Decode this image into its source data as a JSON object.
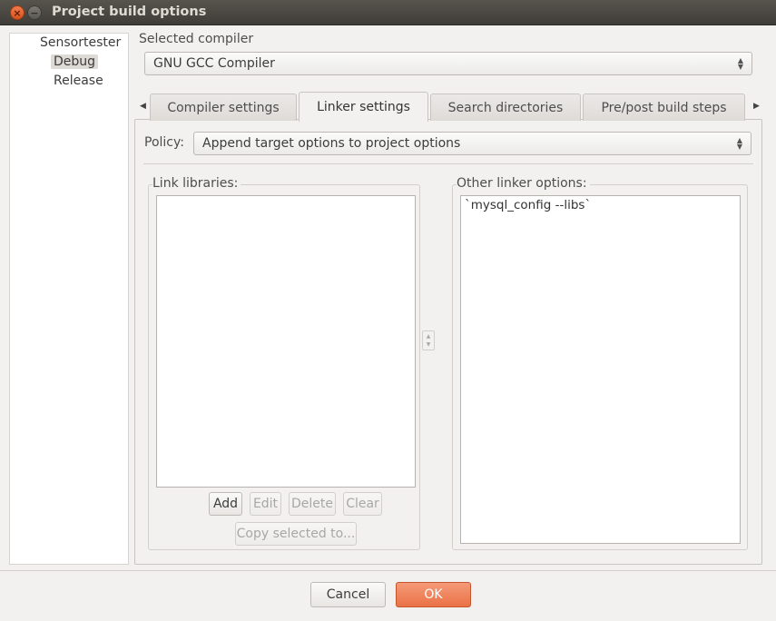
{
  "window": {
    "title": "Project build options"
  },
  "targets": [
    {
      "label": "Sensortester",
      "selected": false
    },
    {
      "label": "Debug",
      "selected": true
    },
    {
      "label": "Release",
      "selected": false
    }
  ],
  "compiler": {
    "label": "Selected compiler",
    "value": "GNU GCC Compiler"
  },
  "tabs": [
    {
      "label": "Compiler settings",
      "active": false
    },
    {
      "label": "Linker settings",
      "active": true
    },
    {
      "label": "Search directories",
      "active": false
    },
    {
      "label": "Pre/post build steps",
      "active": false
    }
  ],
  "policy": {
    "label": "Policy:",
    "value": "Append target options to project options"
  },
  "link_libraries": {
    "label": "Link libraries:",
    "items": [],
    "buttons": {
      "add": "Add",
      "edit": "Edit",
      "delete": "Delete",
      "clear": "Clear",
      "copy": "Copy selected to..."
    }
  },
  "other_linker": {
    "label": "Other linker options:",
    "value": "`mysql_config --libs`"
  },
  "footer": {
    "cancel": "Cancel",
    "ok": "OK"
  },
  "colors": {
    "ok_button": "#ea7246",
    "titlebar": "#4a4843",
    "selected_target": "#dedad5"
  }
}
